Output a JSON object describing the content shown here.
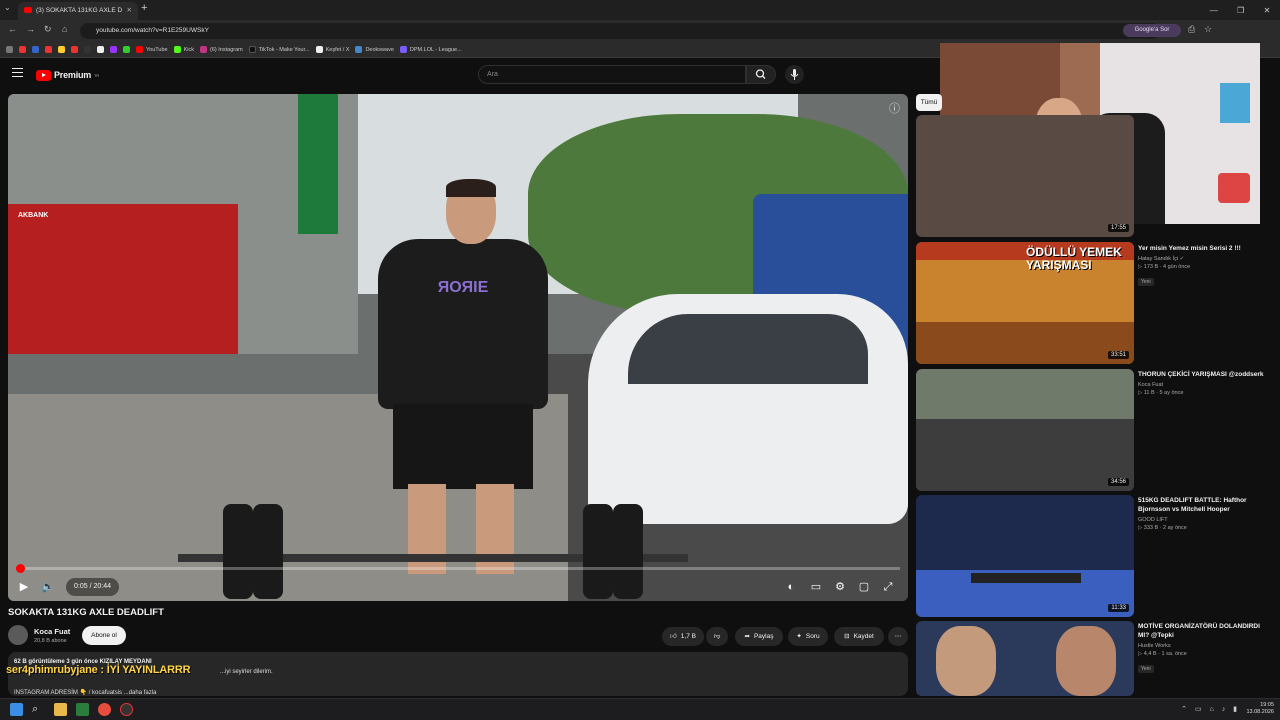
{
  "browser": {
    "tab_title": "(3) SOKAKTA 131KG AXLE D",
    "url": "youtube.com/watch?v=R1E259UWSkY",
    "google_btn": "Google'a Sor",
    "bookmarks": [
      "YouTube",
      "Kick",
      "(6) Instagram",
      "TikTok - Make Your...",
      "Keşfet / X",
      "Deokswave",
      "DPM.LOL - League..."
    ],
    "window_controls": [
      "—",
      "❐",
      "✕"
    ]
  },
  "yt": {
    "brand": "Premium",
    "brand_region": "TR",
    "search_placeholder": "Ara"
  },
  "player": {
    "time": "0:05 / 20:44",
    "progress_fraction": 0.004
  },
  "video": {
    "title": "SOKAKTA 131KG AXLE DEADLIFT",
    "channel": "Koca Fuat",
    "subscribers": "20,8 B abone",
    "subscribe_label": "Abone ol",
    "likes": "1,7 B",
    "share": "Paylaş",
    "ask": "Soru",
    "save": "Kaydet",
    "desc_line1": "62 B görüntüleme  3 gün önce  KIZILAY MEYDANI",
    "desc_line2": "...iyi seyirler dilerim.",
    "desc_line3": "INSTAGRAM ADRESİM 👇 / kocafuatsis   ...daha fazla",
    "overlay_text": "ser4phimrubyjane : İYİ YAYINLARRR"
  },
  "sidebar": {
    "filter_all": "Tümü",
    "videos": [
      {
        "title": "",
        "channel": "",
        "meta": "",
        "duration": "17:55",
        "tag": ""
      },
      {
        "title": "Yer misin Yemez misin Serisi 2 !!!",
        "channel": "Hatay Sandık İçi ✓",
        "meta": "▷ 173 B · 4 gün önce",
        "duration": "33:51",
        "tag": "Yeni",
        "thumb_text": "ÖDÜLLÜ YEMEK YARIŞMASI"
      },
      {
        "title": "THORUN ÇEKİCİ YARIŞMASI @zoddserk",
        "channel": "Koca Fuat",
        "meta": "▷ 11 B · 5 ay önce",
        "duration": "34:56",
        "tag": ""
      },
      {
        "title": "515KG DEADLIFT BATTLE: Hafthor Bjornsson vs Mitchell Hooper",
        "channel": "GOOD LIFT",
        "meta": "▷ 333 B · 2 ay önce",
        "duration": "11:33",
        "tag": ""
      },
      {
        "title": "MOTİVE ORGANİZATÖRÜ DOLANDIRDI MI? @Tepki",
        "channel": "Hustle Works",
        "meta": "▷ 4,4 B · 1 sa. önce",
        "duration": "",
        "tag": "Yeni"
      }
    ]
  },
  "taskbar": {
    "time": "19:05",
    "date": "13.08.2026"
  },
  "colors": {
    "accent": "#ff0000",
    "bg": "#0f0f0f",
    "chip": "#272727"
  }
}
